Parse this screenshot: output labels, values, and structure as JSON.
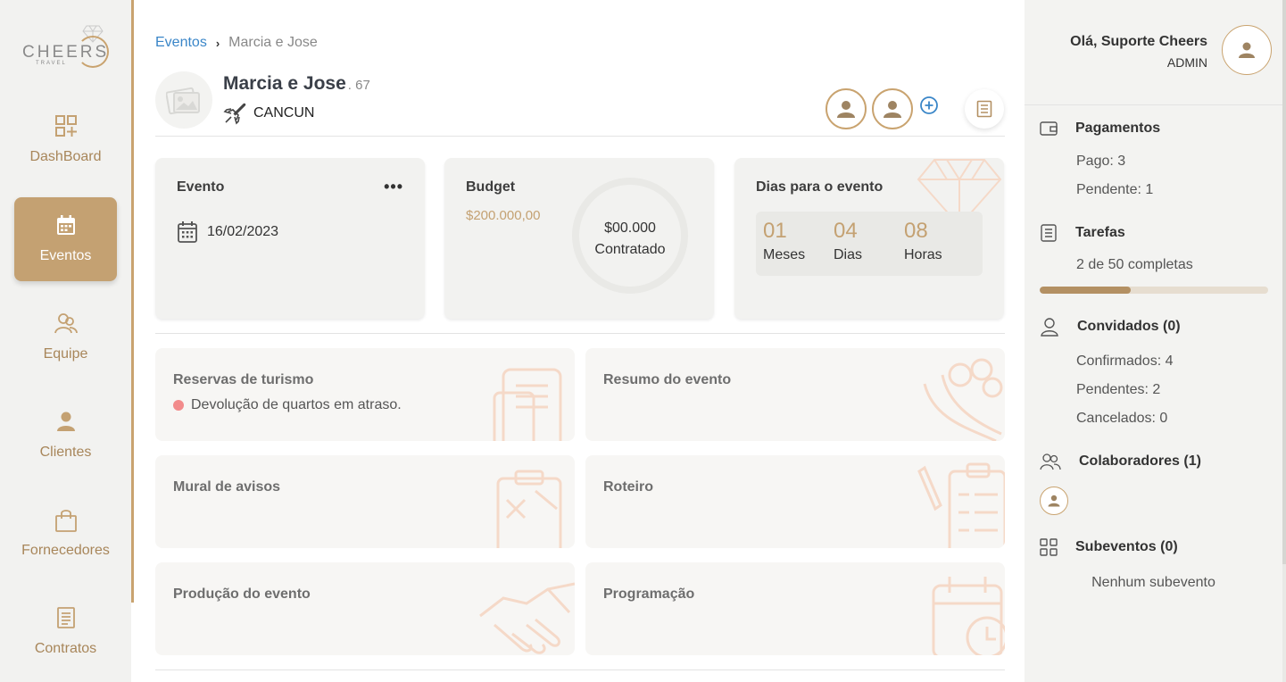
{
  "brand": {
    "logo_word": "CHEERS",
    "logo_sub": "TRAVEL"
  },
  "colors": {
    "accent": "#c4a172",
    "link": "#3a86c8",
    "alert": "#f28b8b",
    "sidebar_bg": "#f2f2f0"
  },
  "sidebar": {
    "items": [
      {
        "label": "DashBoard",
        "icon": "dashboard-icon",
        "active": false
      },
      {
        "label": "Eventos",
        "icon": "calendar-icon",
        "active": true
      },
      {
        "label": "Equipe",
        "icon": "team-icon",
        "active": false
      },
      {
        "label": "Clientes",
        "icon": "person-icon",
        "active": false
      },
      {
        "label": "Fornecedores",
        "icon": "bag-icon",
        "active": false
      },
      {
        "label": "Contratos",
        "icon": "document-icon",
        "active": false
      }
    ]
  },
  "breadcrumb": {
    "root": "Eventos",
    "separator": "›",
    "current": "Marcia e Jose"
  },
  "event": {
    "name": "Marcia e Jose",
    "id": ". 67",
    "destination": "CANCUN"
  },
  "cards": {
    "evento": {
      "title": "Evento",
      "menu": "•••",
      "date": "16/02/2023"
    },
    "budget": {
      "title": "Budget",
      "value": "$200.000,00",
      "contracted_amount": "$00.000",
      "contracted_label": "Contratado"
    },
    "countdown": {
      "title": "Dias para o evento",
      "units": [
        {
          "value": "01",
          "label": "Meses"
        },
        {
          "value": "04",
          "label": "Dias"
        },
        {
          "value": "08",
          "label": "Horas"
        }
      ]
    }
  },
  "panels": {
    "reservas": {
      "title": "Reservas de turismo",
      "alert": "Devolução de quartos em atraso."
    },
    "resumo": {
      "title": "Resumo do evento"
    },
    "mural": {
      "title": "Mural de avisos"
    },
    "roteiro": {
      "title": "Roteiro"
    },
    "producao": {
      "title": "Produção do evento"
    },
    "programacao": {
      "title": "Programação"
    }
  },
  "user": {
    "greeting": "Olá, Suporte Cheers",
    "role": "ADMIN"
  },
  "summary": {
    "pagamentos": {
      "title": "Pagamentos",
      "pago": "Pago: 3",
      "pendente": "Pendente: 1"
    },
    "tarefas": {
      "title": "Tarefas",
      "progress_text": "2 de 50 completas",
      "progress_fraction": 0.4
    },
    "convidados": {
      "title": "Convidados (0)",
      "confirmados": "Confirmados: 4",
      "pendentes": "Pendentes: 2",
      "cancelados": "Cancelados: 0"
    },
    "colaboradores": {
      "title": "Colaboradores (1)"
    },
    "subeventos": {
      "title": "Subeventos (0)",
      "empty": "Nenhum subevento"
    }
  }
}
